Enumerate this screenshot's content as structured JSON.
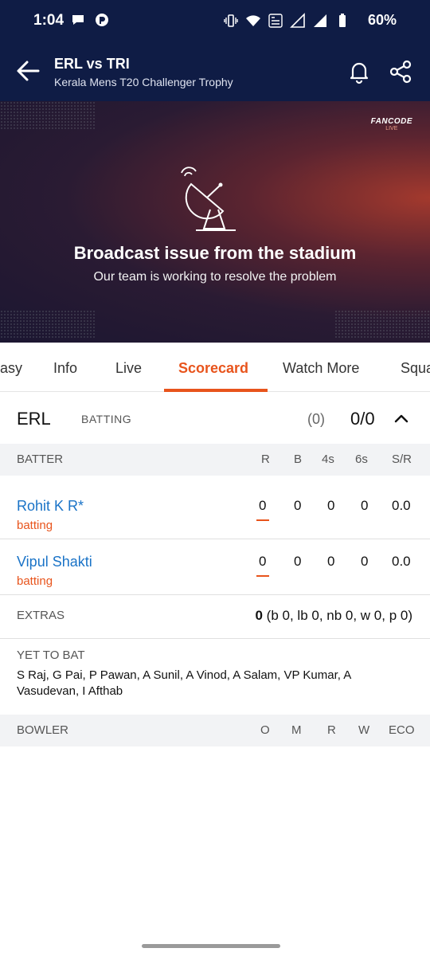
{
  "status_bar": {
    "time": "1:04",
    "battery": "60%"
  },
  "header": {
    "title": "ERL vs TRI",
    "subtitle": "Kerala Mens T20 Challenger Trophy"
  },
  "video": {
    "brand": "FANCODE",
    "brand_sub": "LIVE",
    "message_title": "Broadcast issue from the stadium",
    "message_sub": "Our team is working to resolve the problem"
  },
  "tabs": [
    {
      "label": "asy"
    },
    {
      "label": "Info"
    },
    {
      "label": "Live"
    },
    {
      "label": "Scorecard"
    },
    {
      "label": "Watch More"
    },
    {
      "label": "Squa"
    }
  ],
  "innings": {
    "team": "ERL",
    "status": "BATTING",
    "overs": "(0)",
    "score": "0/0"
  },
  "batting_header": {
    "label": "BATTER",
    "cols": [
      "R",
      "B",
      "4s",
      "6s",
      "S/R"
    ]
  },
  "batters": [
    {
      "name": "Rohit K R*",
      "status": "batting",
      "r": "0",
      "b": "0",
      "fours": "0",
      "sixes": "0",
      "sr": "0.0"
    },
    {
      "name": "Vipul Shakti",
      "status": "batting",
      "r": "0",
      "b": "0",
      "fours": "0",
      "sixes": "0",
      "sr": "0.0"
    }
  ],
  "extras": {
    "label": "EXTRAS",
    "total": "0",
    "detail": " (b 0, lb 0, nb 0, w 0, p 0)"
  },
  "yet_to_bat": {
    "label": "YET TO BAT",
    "names": "S Raj, G Pai, P Pawan, A Sunil, A Vinod, A Salam, VP Kumar, A Vasudevan, I Afthab"
  },
  "bowling_header": {
    "label": "BOWLER",
    "cols": [
      "O",
      "M",
      "R",
      "W",
      "ECO"
    ]
  },
  "colors": {
    "header_bg": "#0f1c45",
    "accent": "#e8541c",
    "link": "#1a73c7"
  }
}
